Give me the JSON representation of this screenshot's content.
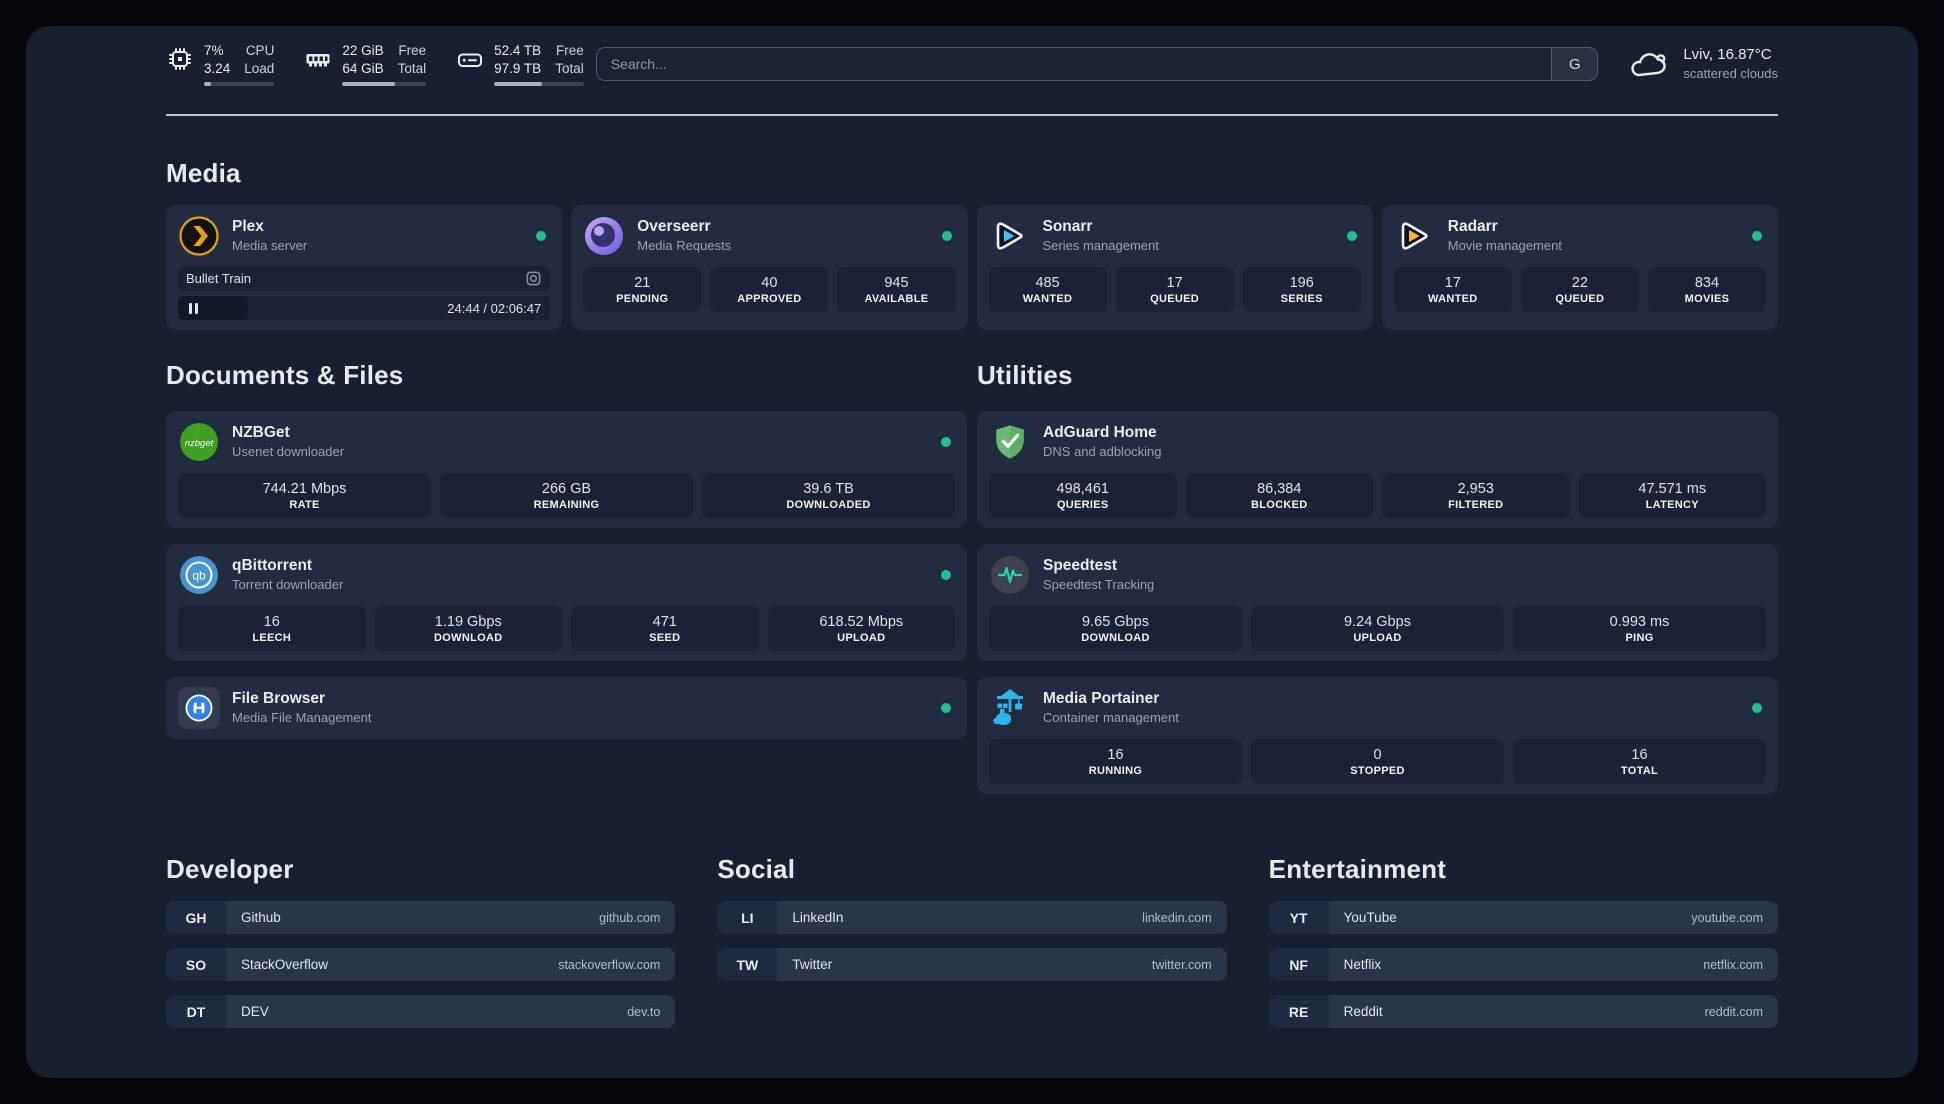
{
  "topbar": {
    "resources": [
      {
        "values": [
          "7%",
          "3.24"
        ],
        "labels": [
          "CPU",
          "Load"
        ],
        "progress_pct": 10
      },
      {
        "values": [
          "22 GiB",
          "64 GiB"
        ],
        "labels": [
          "Free",
          "Total"
        ],
        "progress_pct": 63
      },
      {
        "values": [
          "52.4 TB",
          "97.9 TB"
        ],
        "labels": [
          "Free",
          "Total"
        ],
        "progress_pct": 53
      }
    ],
    "search": {
      "placeholder": "Search...",
      "button_label": "G"
    },
    "weather": {
      "title": "Lviv, 16.87°C",
      "subtitle": "scattered clouds"
    }
  },
  "media": {
    "title": "Media",
    "plex": {
      "title": "Plex",
      "subtitle": "Media server",
      "now_playing": "Bullet Train",
      "time": "24:44 / 02:06:47"
    },
    "overseerr": {
      "title": "Overseerr",
      "subtitle": "Media Requests",
      "stats": [
        {
          "value": "21",
          "label": "PENDING"
        },
        {
          "value": "40",
          "label": "APPROVED"
        },
        {
          "value": "945",
          "label": "AVAILABLE"
        }
      ]
    },
    "sonarr": {
      "title": "Sonarr",
      "subtitle": "Series management",
      "stats": [
        {
          "value": "485",
          "label": "WANTED"
        },
        {
          "value": "17",
          "label": "QUEUED"
        },
        {
          "value": "196",
          "label": "SERIES"
        }
      ]
    },
    "radarr": {
      "title": "Radarr",
      "subtitle": "Movie management",
      "stats": [
        {
          "value": "17",
          "label": "WANTED"
        },
        {
          "value": "22",
          "label": "QUEUED"
        },
        {
          "value": "834",
          "label": "MOVIES"
        }
      ]
    }
  },
  "documents": {
    "title": "Documents & Files",
    "nzbget": {
      "title": "NZBGet",
      "subtitle": "Usenet downloader",
      "icon_text": "nzbget",
      "stats": [
        {
          "value": "744.21 Mbps",
          "label": "RATE"
        },
        {
          "value": "266 GB",
          "label": "REMAINING"
        },
        {
          "value": "39.6 TB",
          "label": "DOWNLOADED"
        }
      ]
    },
    "qbittorrent": {
      "title": "qBittorrent",
      "subtitle": "Torrent downloader",
      "icon_text": "qb",
      "stats": [
        {
          "value": "16",
          "label": "LEECH"
        },
        {
          "value": "1.19 Gbps",
          "label": "DOWNLOAD"
        },
        {
          "value": "471",
          "label": "SEED"
        },
        {
          "value": "618.52 Mbps",
          "label": "UPLOAD"
        }
      ]
    },
    "filebrowser": {
      "title": "File Browser",
      "subtitle": "Media File Management"
    }
  },
  "utilities": {
    "title": "Utilities",
    "adguard": {
      "title": "AdGuard Home",
      "subtitle": "DNS and adblocking",
      "stats": [
        {
          "value": "498,461",
          "label": "QUERIES"
        },
        {
          "value": "86,384",
          "label": "BLOCKED"
        },
        {
          "value": "2,953",
          "label": "FILTERED"
        },
        {
          "value": "47.571 ms",
          "label": "LATENCY"
        }
      ]
    },
    "speedtest": {
      "title": "Speedtest",
      "subtitle": "Speedtest Tracking",
      "stats": [
        {
          "value": "9.65 Gbps",
          "label": "DOWNLOAD"
        },
        {
          "value": "9.24 Gbps",
          "label": "UPLOAD"
        },
        {
          "value": "0.993 ms",
          "label": "PING"
        }
      ]
    },
    "portainer": {
      "title": "Media Portainer",
      "subtitle": "Container management",
      "stats": [
        {
          "value": "16",
          "label": "RUNNING"
        },
        {
          "value": "0",
          "label": "STOPPED"
        },
        {
          "value": "16",
          "label": "TOTAL"
        }
      ]
    }
  },
  "bookmarks": {
    "developer": {
      "title": "Developer",
      "items": [
        {
          "abbr": "GH",
          "name": "Github",
          "domain": "github.com"
        },
        {
          "abbr": "SO",
          "name": "StackOverflow",
          "domain": "stackoverflow.com"
        },
        {
          "abbr": "DT",
          "name": "DEV",
          "domain": "dev.to"
        }
      ]
    },
    "social": {
      "title": "Social",
      "items": [
        {
          "abbr": "LI",
          "name": "LinkedIn",
          "domain": "linkedin.com"
        },
        {
          "abbr": "TW",
          "name": "Twitter",
          "domain": "twitter.com"
        }
      ]
    },
    "entertainment": {
      "title": "Entertainment",
      "items": [
        {
          "abbr": "YT",
          "name": "YouTube",
          "domain": "youtube.com"
        },
        {
          "abbr": "NF",
          "name": "Netflix",
          "domain": "netflix.com"
        },
        {
          "abbr": "RE",
          "name": "Reddit",
          "domain": "reddit.com"
        }
      ]
    }
  },
  "colors": {
    "status_online": "#22c08b",
    "accent_plex": "#e5a00d"
  }
}
